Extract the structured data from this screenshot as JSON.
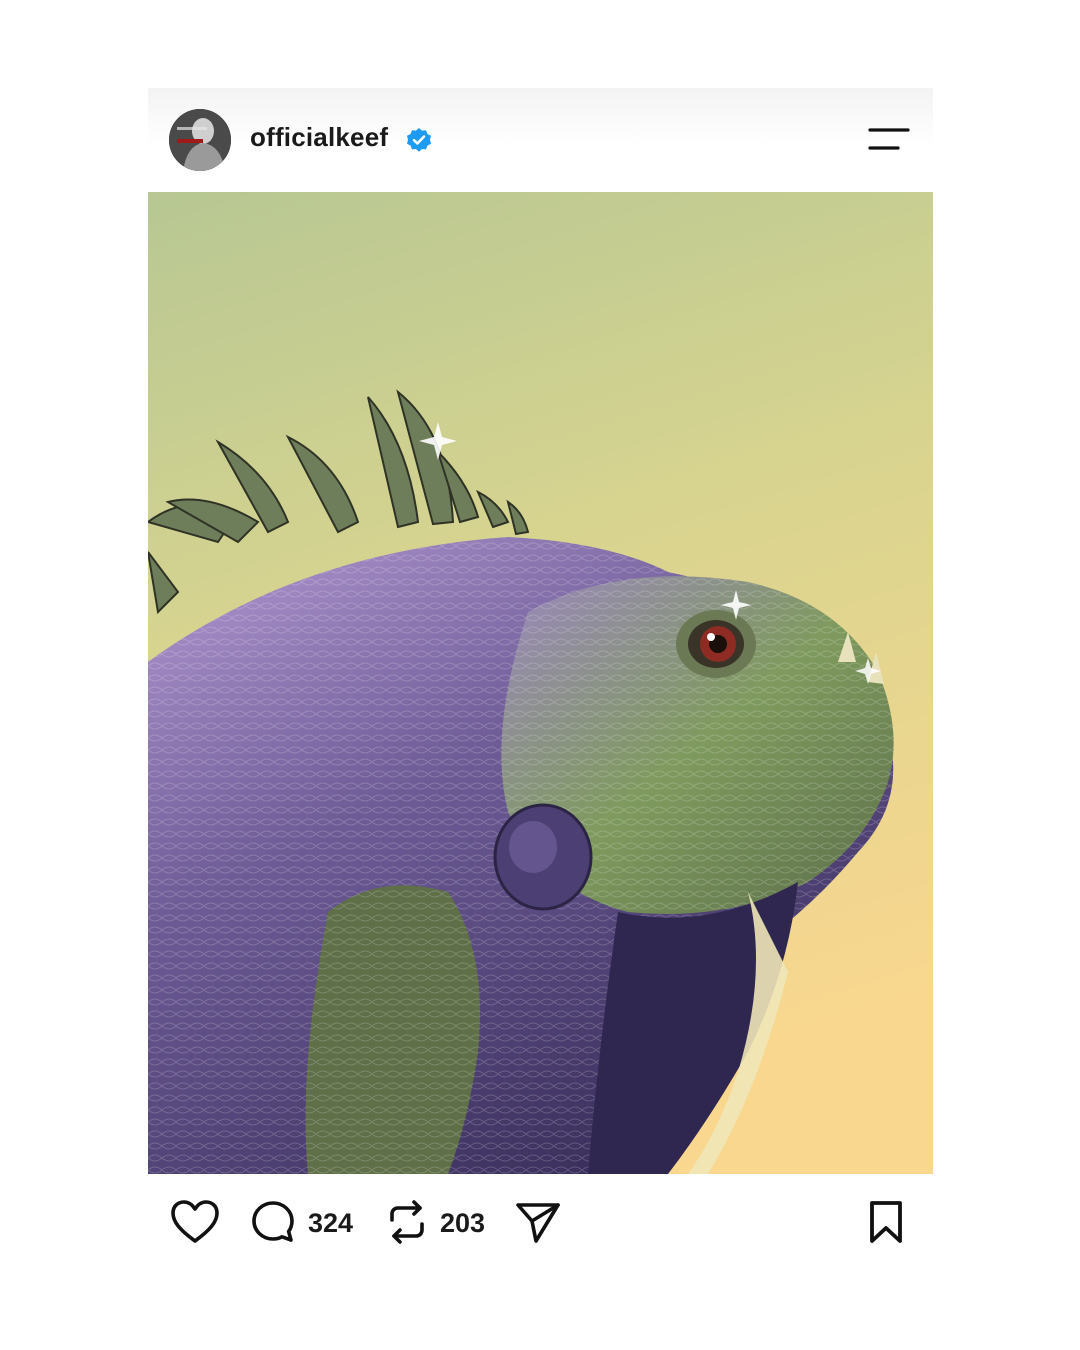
{
  "post": {
    "username": "officialkeef",
    "verified": true,
    "avatar_icon": "profile-photo",
    "menu_icon": "menu-lines-icon",
    "image_subject": "illustrated purple and green iguana on a green-to-yellow gradient background"
  },
  "actions": {
    "like_icon": "heart-icon",
    "comment_icon": "comment-bubble-icon",
    "comment_count": "324",
    "repost_icon": "repost-icon",
    "repost_count": "203",
    "share_icon": "send-icon",
    "save_icon": "bookmark-icon"
  },
  "colors": {
    "bg_top": "#b7c793",
    "bg_bottom": "#f9d78f",
    "iguana_purple": "#4b3f73",
    "iguana_lilac": "#b59bd4",
    "iguana_green": "#7f9a5e",
    "verified_blue": "#1d9bf0"
  }
}
